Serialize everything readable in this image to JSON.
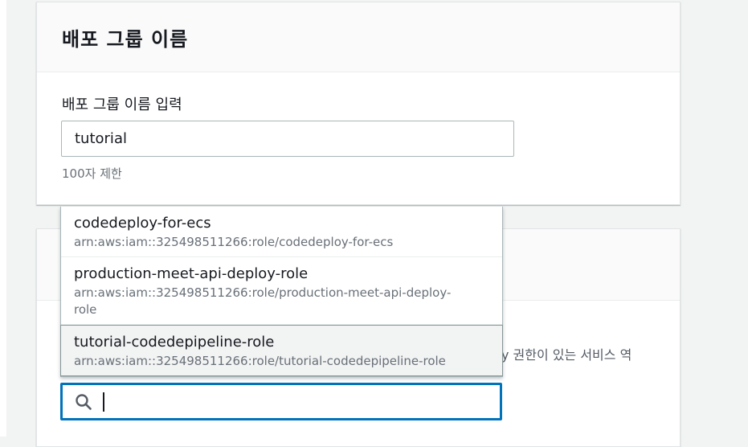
{
  "deployment_group": {
    "title": "배포 그룹 이름",
    "field_label": "배포 그룹 이름 입력",
    "input_value": "tutorial",
    "hint": "100자 제한"
  },
  "service_role": {
    "description_tail": "y 권한이 있는 서비스 역",
    "options": [
      {
        "name": "codedeploy-for-ecs",
        "arn": "arn:aws:iam::325498511266:role/codedeploy-for-ecs"
      },
      {
        "name": "production-meet-api-deploy-role",
        "arn": "arn:aws:iam::325498511266:role/production-meet-api-deploy-role"
      },
      {
        "name": "tutorial-codedepipeline-role",
        "arn": "arn:aws:iam::325498511266:role/tutorial-codedepipeline-role"
      }
    ],
    "search_value": ""
  }
}
